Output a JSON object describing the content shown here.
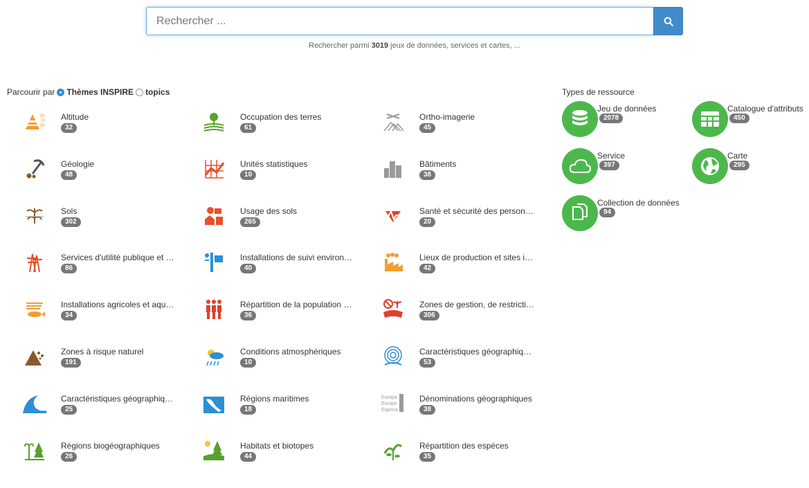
{
  "search": {
    "placeholder": "Rechercher ...",
    "hint_prefix": "Rechercher parmi",
    "hint_count": "3019",
    "hint_suffix": "jeux de données, services et cartes, ..."
  },
  "browse": {
    "prefix": "Parcourir par",
    "option_inspire": "Thèmes INSPIRE",
    "option_topics": "topics",
    "selected": "Thèmes INSPIRE"
  },
  "themes": [
    {
      "label": "Altitude",
      "count": "32",
      "icon": "altitude-icon",
      "color": "#f39c32"
    },
    {
      "label": "Occupation des terres",
      "count": "61",
      "icon": "land-cover-icon",
      "color": "#5aa02c"
    },
    {
      "label": "Ortho-imagerie",
      "count": "45",
      "icon": "orthoimagery-icon",
      "color": "#9a9a9a"
    },
    {
      "label": "Géologie",
      "count": "48",
      "icon": "geology-icon",
      "color": "#8b5a2b"
    },
    {
      "label": "Unités statistiques",
      "count": "10",
      "icon": "statistical-units-icon",
      "color": "#e8502b"
    },
    {
      "label": "Bâtiments",
      "count": "38",
      "icon": "buildings-icon",
      "color": "#9a9a9a"
    },
    {
      "label": "Sols",
      "count": "302",
      "icon": "soil-icon",
      "color": "#8b5a2b"
    },
    {
      "label": "Usage des sols",
      "count": "265",
      "icon": "land-use-icon",
      "color": "#e8502b"
    },
    {
      "label": "Santé et sécurité des person…",
      "count": "20",
      "icon": "health-safety-icon",
      "color": "#e0402b"
    },
    {
      "label": "Services d'utilité publique et …",
      "count": "86",
      "icon": "utility-services-icon",
      "color": "#e8502b"
    },
    {
      "label": "Installations de suivi environ…",
      "count": "40",
      "icon": "monitoring-icon",
      "color": "#2d8fd5"
    },
    {
      "label": "Lieux de production et sites i…",
      "count": "42",
      "icon": "production-sites-icon",
      "color": "#f39c32"
    },
    {
      "label": "Installations agricoles et aqu…",
      "count": "34",
      "icon": "agriculture-icon",
      "color": "#f39c32"
    },
    {
      "label": "Répartition de la population …",
      "count": "36",
      "icon": "population-icon",
      "color": "#e0402b"
    },
    {
      "label": "Zones de gestion, de restricti…",
      "count": "306",
      "icon": "management-zones-icon",
      "color": "#e0402b"
    },
    {
      "label": "Zones à risque naturel",
      "count": "191",
      "icon": "natural-risk-icon",
      "color": "#8b5a2b"
    },
    {
      "label": "Conditions atmosphériques",
      "count": "10",
      "icon": "atmospheric-icon",
      "color": "#2d8fd5"
    },
    {
      "label": "Caractéristiques géographiq…",
      "count": "53",
      "icon": "meteorological-icon",
      "color": "#2d8fd5"
    },
    {
      "label": "Caractéristiques géographiq…",
      "count": "25",
      "icon": "oceanographic-icon",
      "color": "#2d8fd5"
    },
    {
      "label": "Régions maritimes",
      "count": "18",
      "icon": "sea-regions-icon",
      "color": "#2d8fd5"
    },
    {
      "label": "Dénominations géographiques",
      "count": "38",
      "icon": "geographical-names-icon",
      "color": "#9a9a9a"
    },
    {
      "label": "Régions biogéographiques",
      "count": "26",
      "icon": "bio-regions-icon",
      "color": "#5aa02c"
    },
    {
      "label": "Habitats et biotopes",
      "count": "44",
      "icon": "habitats-icon",
      "color": "#5aa02c"
    },
    {
      "label": "Répartition des espèces",
      "count": "35",
      "icon": "species-icon",
      "color": "#5aa02c"
    }
  ],
  "resource_types": {
    "title": "Types de ressource",
    "items": [
      {
        "label": "Jeu de données",
        "count": "2078",
        "icon": "database-icon"
      },
      {
        "label": "Catalogue d'attributs",
        "count": "450",
        "icon": "table-icon"
      },
      {
        "label": "Service",
        "count": "397",
        "icon": "cloud-icon"
      },
      {
        "label": "Carte",
        "count": "295",
        "icon": "globe-icon"
      },
      {
        "label": "Collection de données",
        "count": "94",
        "icon": "copy-icon"
      }
    ]
  },
  "colors": {
    "accent": "#428bca",
    "badge": "#777777",
    "resource_green": "#4cb84c"
  }
}
